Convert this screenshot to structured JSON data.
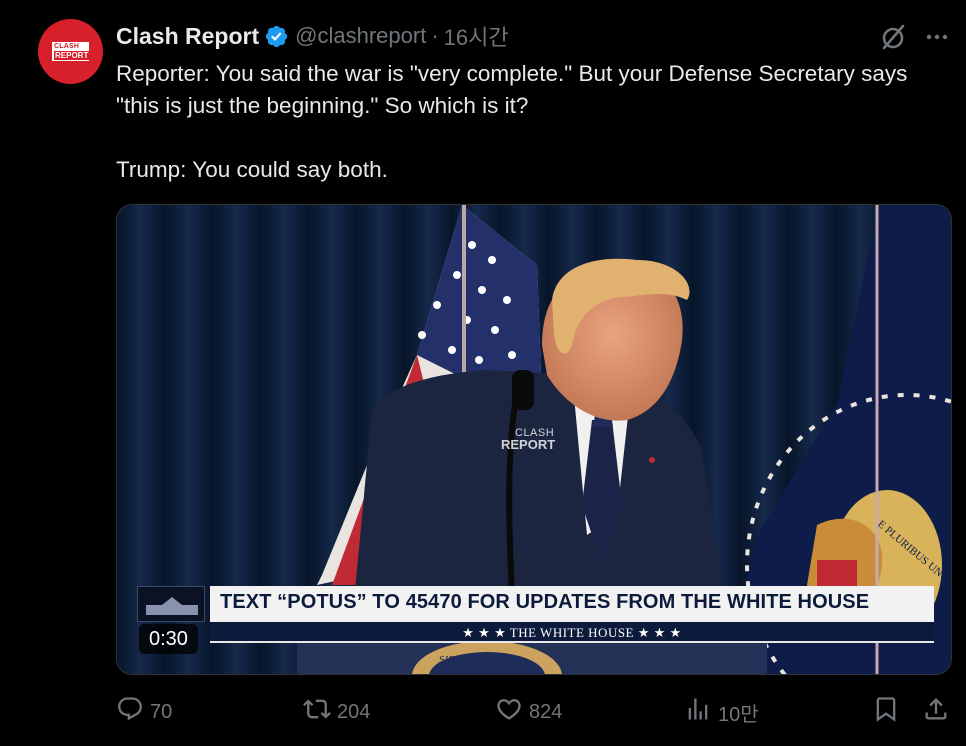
{
  "author": {
    "display_name": "Clash Report",
    "handle": "@clashreport",
    "separator": "·",
    "time": "16시간",
    "avatar_text_top": "CLASH",
    "avatar_text_bottom": "REPORT",
    "verified": true
  },
  "tweet": {
    "line1": "Reporter: You said the war is \"very complete.\" But your Defense Secretary says \"this is just the beginning.\" So which is it?",
    "line2": "Trump: You could say both."
  },
  "media": {
    "watermark_top": "CLASH",
    "watermark_bottom": "REPORT",
    "chyron_main": "TEXT “POTUS” TO 45470 FOR UPDATES FROM THE WHITE HOUSE",
    "chyron_sub": "★ ★ ★   THE WHITE HOUSE   ★ ★ ★",
    "seal_text": "E PLURIBUS UNUM",
    "podium_text": "SIDENT OF THE",
    "duration": "0:30"
  },
  "actions": {
    "replies": "70",
    "reposts": "204",
    "likes": "824",
    "views": "10만"
  },
  "colors": {
    "background": "#000000",
    "text": "#e7e9ea",
    "muted": "#71767b",
    "verified": "#1d9bf0",
    "avatar": "#d7202a"
  },
  "icons": [
    "verified-badge-icon",
    "grok-icon",
    "more-icon",
    "reply-icon",
    "repost-icon",
    "like-icon",
    "views-icon",
    "bookmark-icon",
    "share-icon"
  ]
}
